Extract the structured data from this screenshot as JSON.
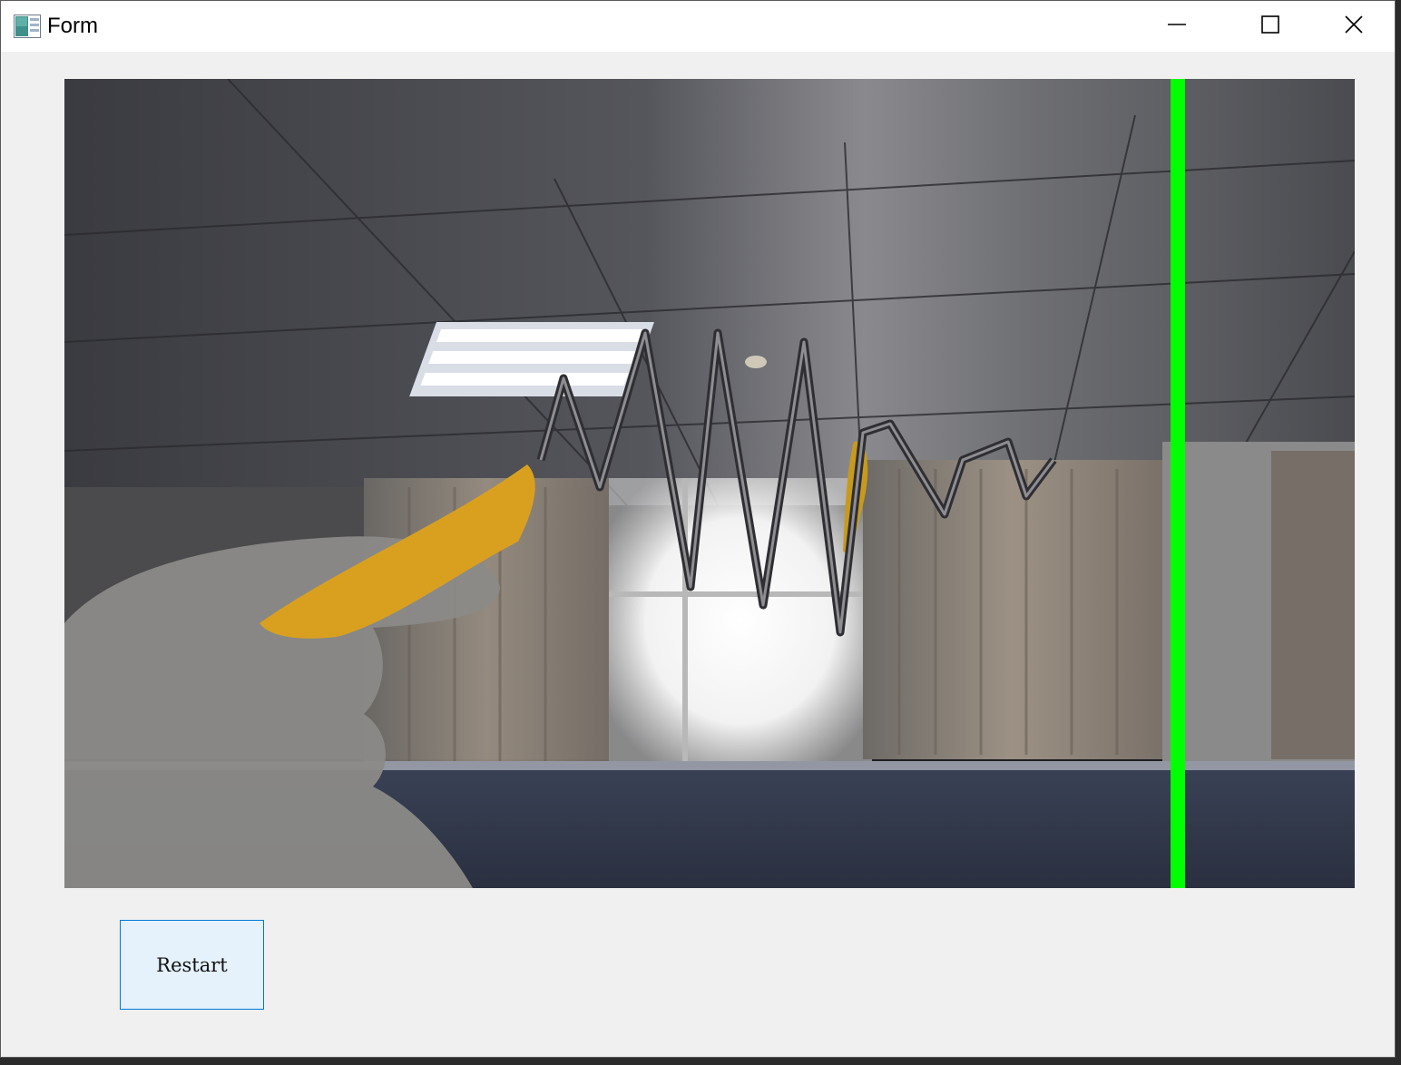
{
  "window": {
    "title": "Form",
    "app_icon": "form-app-icon",
    "controls": [
      "minimize-icon",
      "maximize-icon",
      "close-icon"
    ]
  },
  "camera_view": {
    "description_icon": "camera-feed",
    "marker_color": "#00ff00"
  },
  "restart_button": {
    "label": "Restart"
  }
}
